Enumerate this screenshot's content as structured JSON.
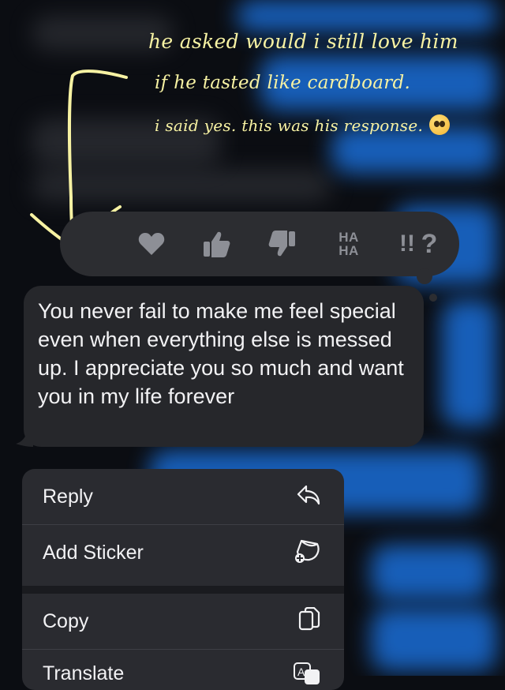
{
  "caption": {
    "line1": "he asked would i still love him",
    "line2": "if he tasted like cardboard.",
    "line3": "i said yes. this was his response."
  },
  "tapback": {
    "items": [
      {
        "name": "heart-icon"
      },
      {
        "name": "thumbs-up-icon"
      },
      {
        "name": "thumbs-down-icon"
      },
      {
        "name": "haha-icon",
        "text_top": "HA",
        "text_bottom": "HA"
      },
      {
        "name": "exclamation-icon",
        "text": "!!"
      },
      {
        "name": "question-icon",
        "text": "?"
      }
    ]
  },
  "message": {
    "text": "You never fail to make me feel special even when everything else is messed up. I appreciate you so much and want you in my life forever"
  },
  "menu": {
    "items": [
      {
        "label": "Reply",
        "icon": "reply-icon"
      },
      {
        "label": "Add Sticker",
        "icon": "sticker-icon"
      },
      {
        "label": "Copy",
        "icon": "copy-icon"
      },
      {
        "label": "Translate",
        "icon": "translate-icon"
      }
    ]
  },
  "colors": {
    "caption": "#f7f2a3",
    "bubble": "#26272b",
    "menu": "#2a2b30",
    "imessage_blue": "#1a6dd6"
  }
}
